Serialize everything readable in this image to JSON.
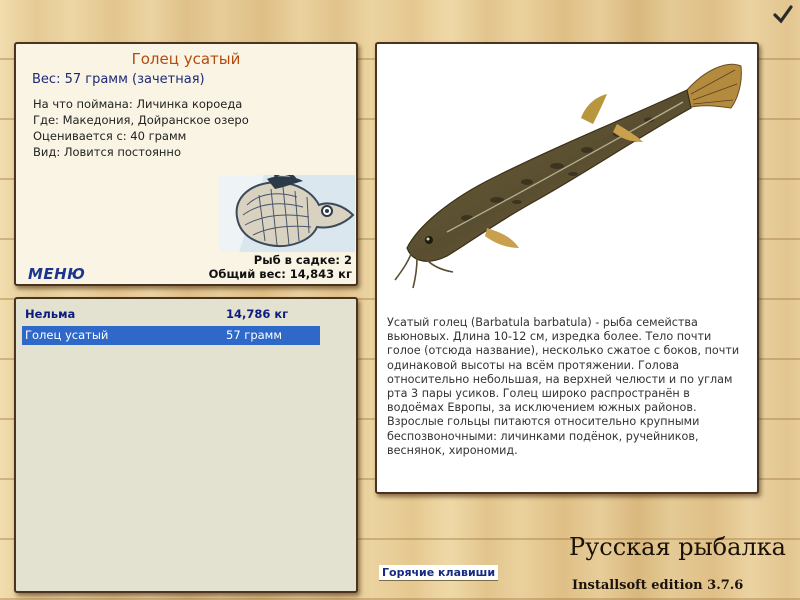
{
  "info": {
    "title": "Голец усатый",
    "weight": "Вес: 57 грамм (зачетная)",
    "caught_on": "На что поймана: Личинка короеда",
    "location": "Где: Македония, Дойранское озеро",
    "valued_from": "Оценивается с: 40 грамм",
    "kind": "Вид: Ловится постоянно",
    "menu_label": "МЕНЮ",
    "in_cage": "Рыб в садке: 2",
    "total_weight": "Общий вес: 14,843 кг"
  },
  "catch_list": [
    {
      "name": "Нельма",
      "value": "14,786 кг"
    },
    {
      "name": "Голец усатый",
      "value": "57 грамм"
    }
  ],
  "description": "Усатый голец (Barbatula barbatula) - рыба семейства вьюновых. Длина 10-12 см, изредка более. Тело почти голое (отсюда название), несколько сжатое с боков, почти одинаковой высоты на всём протяжении. Голова относительно небольшая, на верхней челюсти и по углам рта 3 пары усиков. Голец широко распространён в водоёмах Европы, за исключением южных районов. Взрослые гольцы питаются относительно крупными беспозвоночными: личинками подёнок, ручейников, веснянок, хирономид.",
  "footer": {
    "hotkeys": "Горячие клавиши",
    "brand": "Русская рыбалка",
    "edition": "Installsoft edition 3.7.6"
  },
  "icons": {
    "confirm": "checkmark-icon",
    "logo": "fish-logo-icon"
  },
  "colors": {
    "title": "#b54a10",
    "accent_blue": "#1d2a7a",
    "selection": "#2e68c8"
  }
}
